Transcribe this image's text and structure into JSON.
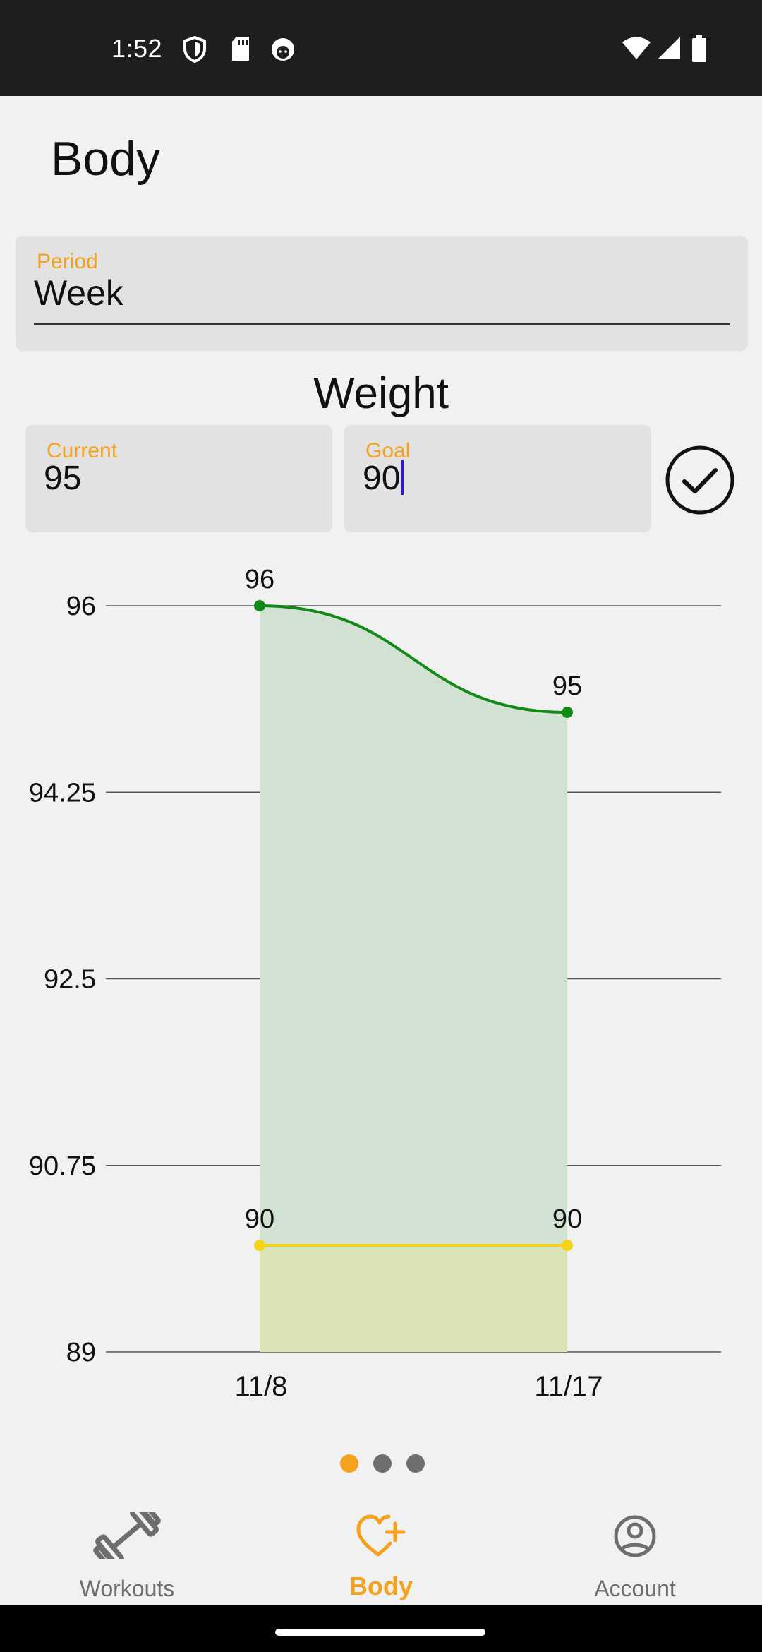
{
  "status_bar": {
    "time": "1:52",
    "left_icons": [
      "shield-icon",
      "sd-card-icon",
      "face-icon"
    ],
    "right_icons": [
      "wifi-icon",
      "signal-icon",
      "battery-icon"
    ]
  },
  "page": {
    "title": "Body"
  },
  "period": {
    "label": "Period",
    "value": "Week"
  },
  "weight": {
    "title": "Weight",
    "current_label": "Current",
    "current_value": "95",
    "goal_label": "Goal",
    "goal_value": "90"
  },
  "chart_data": {
    "type": "area",
    "categories": [
      "11/8",
      "11/17"
    ],
    "series": [
      {
        "values": [
          96,
          95
        ],
        "color": "#118a18",
        "fill": "#d2e2d2"
      },
      {
        "values": [
          90,
          90
        ],
        "color": "#f5d41b",
        "fill": "#dbe3b6"
      }
    ],
    "yticks": [
      "96",
      "94.25",
      "92.5",
      "90.75",
      "89"
    ],
    "ytick_values": [
      96,
      94.25,
      92.5,
      90.75,
      89
    ],
    "ylim": [
      89,
      96
    ],
    "grid": true,
    "data_labels": true,
    "legend": "none"
  },
  "pager": {
    "pages": 3,
    "active_index": 0
  },
  "bottom_nav": {
    "items": [
      {
        "label": "Workouts",
        "icon": "dumbbell-icon",
        "active": false
      },
      {
        "label": "Body",
        "icon": "heart-plus-icon",
        "active": true
      },
      {
        "label": "Account",
        "icon": "account-circle-icon",
        "active": false
      }
    ]
  },
  "colors": {
    "accent": "#f4a21d",
    "weight_line": "#118a18",
    "goal_line": "#f5d41b",
    "caret": "#2d19d9"
  }
}
